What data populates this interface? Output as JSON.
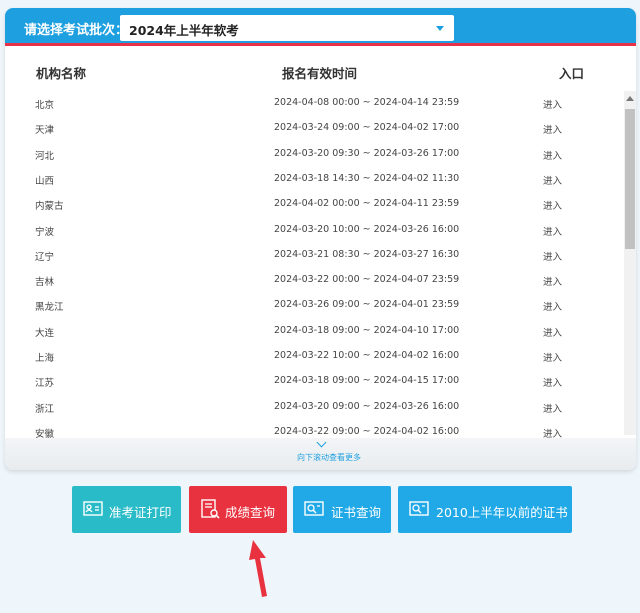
{
  "header": {
    "label": "请选择考试批次：",
    "selected_batch": "2024年上半年软考"
  },
  "table": {
    "columns": [
      "机构名称",
      "报名有效时间",
      "入口"
    ],
    "rows": [
      {
        "name": "北京",
        "time": "2024-04-08 00:00 ~ 2024-04-14 23:59",
        "entry": "进入"
      },
      {
        "name": "天津",
        "time": "2024-03-24 09:00 ~ 2024-04-02 17:00",
        "entry": "进入"
      },
      {
        "name": "河北",
        "time": "2024-03-20 09:30 ~ 2024-03-26 17:00",
        "entry": "进入"
      },
      {
        "name": "山西",
        "time": "2024-03-18 14:30 ~ 2024-04-02 11:30",
        "entry": "进入"
      },
      {
        "name": "内蒙古",
        "time": "2024-04-02 00:00 ~ 2024-04-11 23:59",
        "entry": "进入"
      },
      {
        "name": "宁波",
        "time": "2024-03-20 10:00 ~ 2024-03-26 16:00",
        "entry": "进入"
      },
      {
        "name": "辽宁",
        "time": "2024-03-21 08:30 ~ 2024-03-27 16:30",
        "entry": "进入"
      },
      {
        "name": "吉林",
        "time": "2024-03-22 00:00 ~ 2024-04-07 23:59",
        "entry": "进入"
      },
      {
        "name": "黑龙江",
        "time": "2024-03-26 09:00 ~ 2024-04-01 23:59",
        "entry": "进入"
      },
      {
        "name": "大连",
        "time": "2024-03-18 09:00 ~ 2024-04-10 17:00",
        "entry": "进入"
      },
      {
        "name": "上海",
        "time": "2024-03-22 10:00 ~ 2024-04-02 16:00",
        "entry": "进入"
      },
      {
        "name": "江苏",
        "time": "2024-03-18 09:00 ~ 2024-04-15 17:00",
        "entry": "进入"
      },
      {
        "name": "浙江",
        "time": "2024-03-20 09:00 ~ 2024-03-26 16:00",
        "entry": "进入"
      },
      {
        "name": "安徽",
        "time": "2024-03-22 09:00 ~ 2024-04-02 16:00",
        "entry": "进入"
      }
    ]
  },
  "scroll_hint": "向下滚动查看更多",
  "buttons": {
    "admission": "准考证打印",
    "score": "成绩查询",
    "cert": "证书查询",
    "old_cert": "2010上半年以前的证书"
  },
  "colors": {
    "header_blue": "#1e9fe0",
    "accent_red": "#e8324a",
    "teal": "#29bcc8",
    "score_red": "#e8323f",
    "sky": "#20a9e6"
  },
  "icons": {
    "admission": "id-card-icon",
    "score": "report-search-icon",
    "cert": "certificate-search-icon",
    "old_cert": "certificate-search-icon",
    "annotation": "red-arrow-icon"
  }
}
